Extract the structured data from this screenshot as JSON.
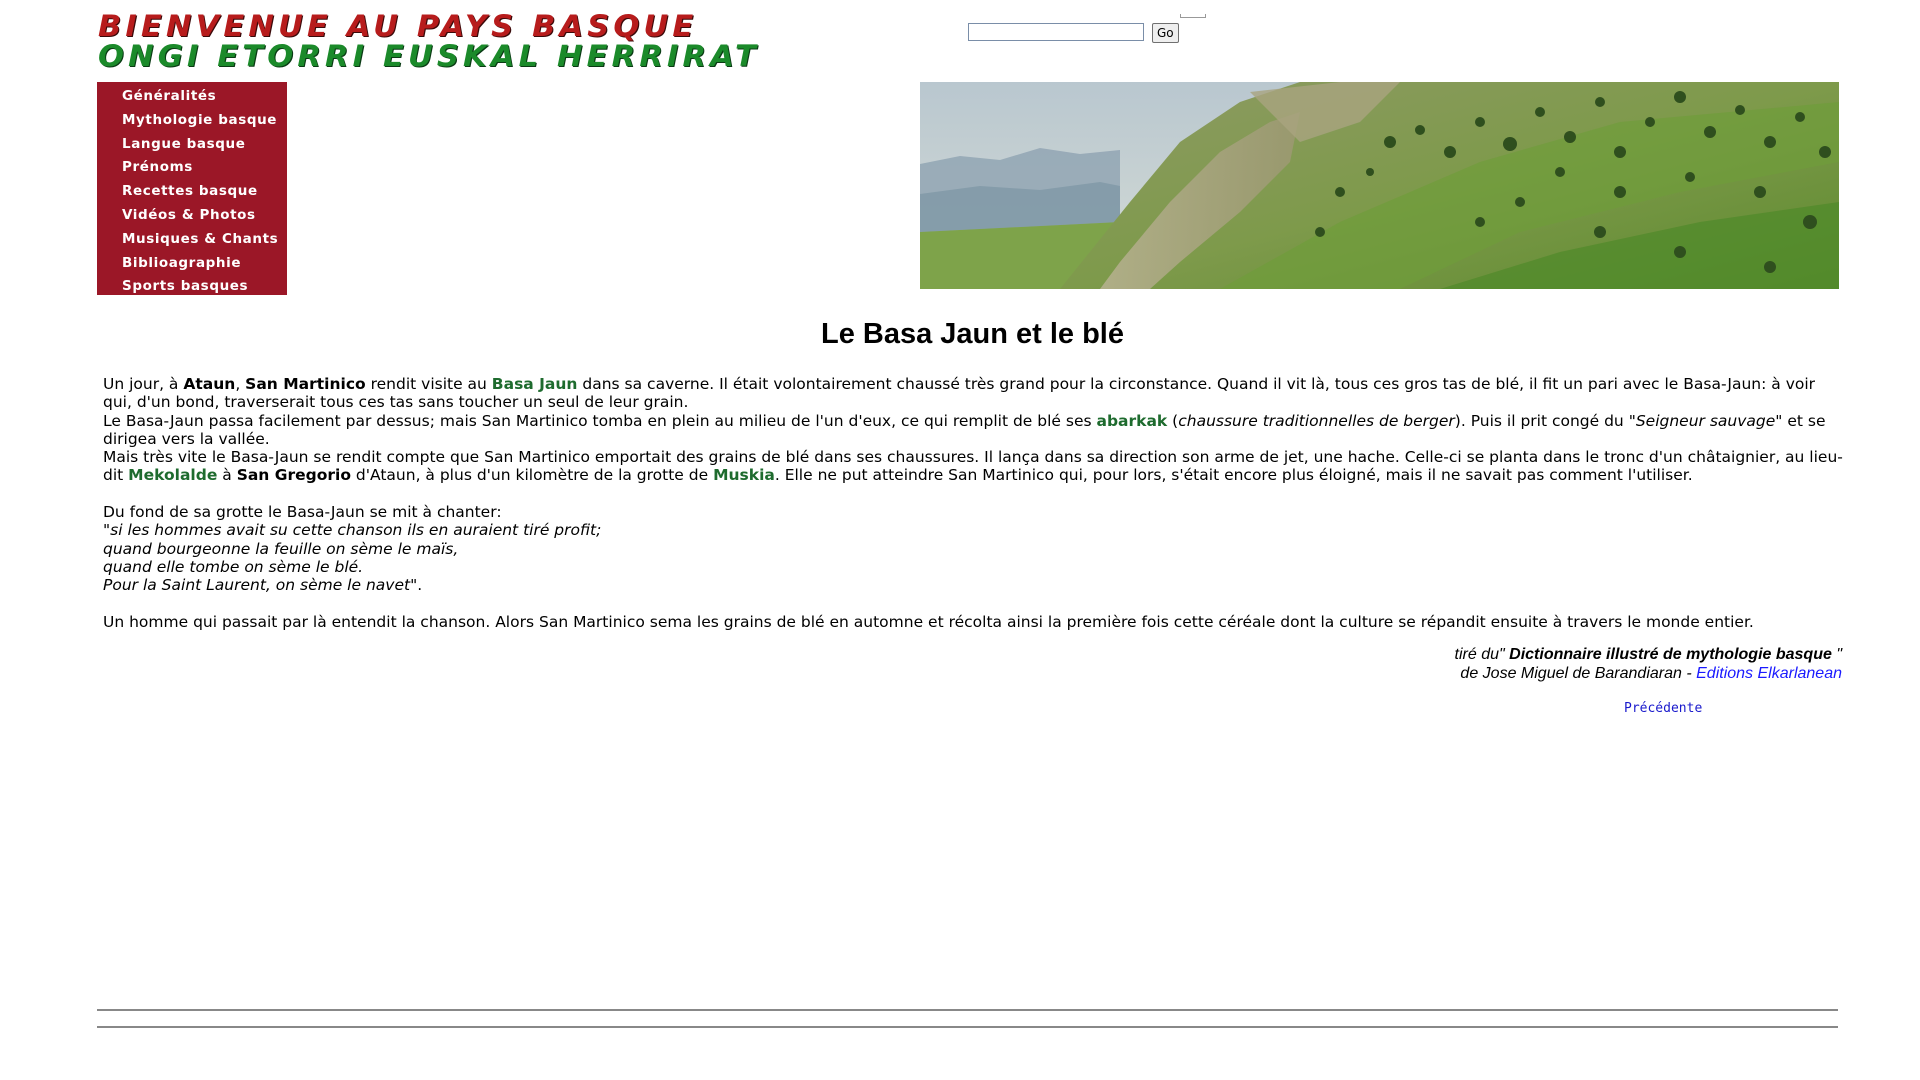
{
  "header": {
    "logo_line1": "BIENVENUE AU PAYS BASQUE",
    "logo_line2": "ONGI ETORRI EUSKAL HERRIRAT"
  },
  "search": {
    "value": "",
    "go_label": "Go"
  },
  "nav": {
    "items": [
      {
        "label": "Généralités"
      },
      {
        "label": "Mythologie basque"
      },
      {
        "label": "Langue basque"
      },
      {
        "label": "Prénoms"
      },
      {
        "label": "Recettes basque"
      },
      {
        "label": "Vidéos & Photos"
      },
      {
        "label": "Musiques & Chants"
      },
      {
        "label": "Biblioagraphie"
      },
      {
        "label": "Sports basques"
      }
    ]
  },
  "article": {
    "title": "Le Basa Jaun et le blé",
    "p1": {
      "a": "Un jour, à ",
      "ataun": "Ataun",
      "b": ", ",
      "san_martinico": "San Martinico",
      "c": " rendit visite au ",
      "basa_jaun": "Basa Jaun",
      "d": " dans sa caverne. Il était volontairement chaussé très grand pour la circonstance. Quand il vit là, tous ces gros tas de blé, il fit un pari avec le Basa-Jaun: à voir qui, d'un bond, traverserait tous ces tas sans toucher un seul de leur grain."
    },
    "p2": {
      "a": "Le Basa-Jaun passa facilement par dessus; mais San Martinico tomba en plein au milieu de l'un d'eux, ce qui remplit de blé ses ",
      "abarkak": "abarkak",
      "b": " (",
      "abarkak_def": "chaussure traditionnelles de berger",
      "c": "). Puis il prit congé du \"",
      "seigneur": "Seigneur sauvage",
      "d": "\" et se dirigea vers la vallée."
    },
    "p3": {
      "a": "Mais très vite le Basa-Jaun se rendit compte que San Martinico emportait des grains de blé dans ses chaussures. Il lança dans sa direction son arme de jet, une hache. Celle-ci se planta dans le tronc d'un châtaignier, au lieu-dit ",
      "mekolalde": "Mekolalde",
      "b": " à ",
      "san_gregorio": "San Gregorio",
      "c": " d'Ataun, à plus d'un kilomètre de la grotte de ",
      "muskia": "Muskia",
      "d": ". Elle ne put atteindre San Martinico qui, pour lors, s'était encore plus éloigné, mais il ne savait pas comment l'utiliser."
    },
    "song_intro": "Du fond de sa grotte le Basa-Jaun se mit à chanter:",
    "song_lines": [
      "si les hommes avait su cette chanson ils en auraient tiré profit;",
      "quand bourgeonne la feuille on sème le maïs,",
      "quand elle tombe on sème le blé.",
      "Pour la Saint Laurent, on sème le navet"
    ],
    "song_open_quote": "\"",
    "song_close": "\".",
    "conclusion": "Un homme qui passait par là entendit la chanson. Alors San Martinico sema les grains de blé en automne et récolta ainsi la première fois cette céréale dont la culture se répandit ensuite à travers le monde entier."
  },
  "credit": {
    "prefix": "tiré du\" ",
    "book": "Dictionnaire illustré de mythologie basque",
    "suffix": " \"",
    "author_line": "de Jose Miguel de Barandiaran - ",
    "publisher": "Editions Elkarlanean"
  },
  "nav_links": {
    "previous": "Précédente"
  },
  "colors": {
    "menu_bg": "#9b1727",
    "term_green": "#1e6b2e",
    "link_blue": "#1a1aff",
    "logo_red": "#b71c1c",
    "logo_green": "#1b8a2a"
  }
}
